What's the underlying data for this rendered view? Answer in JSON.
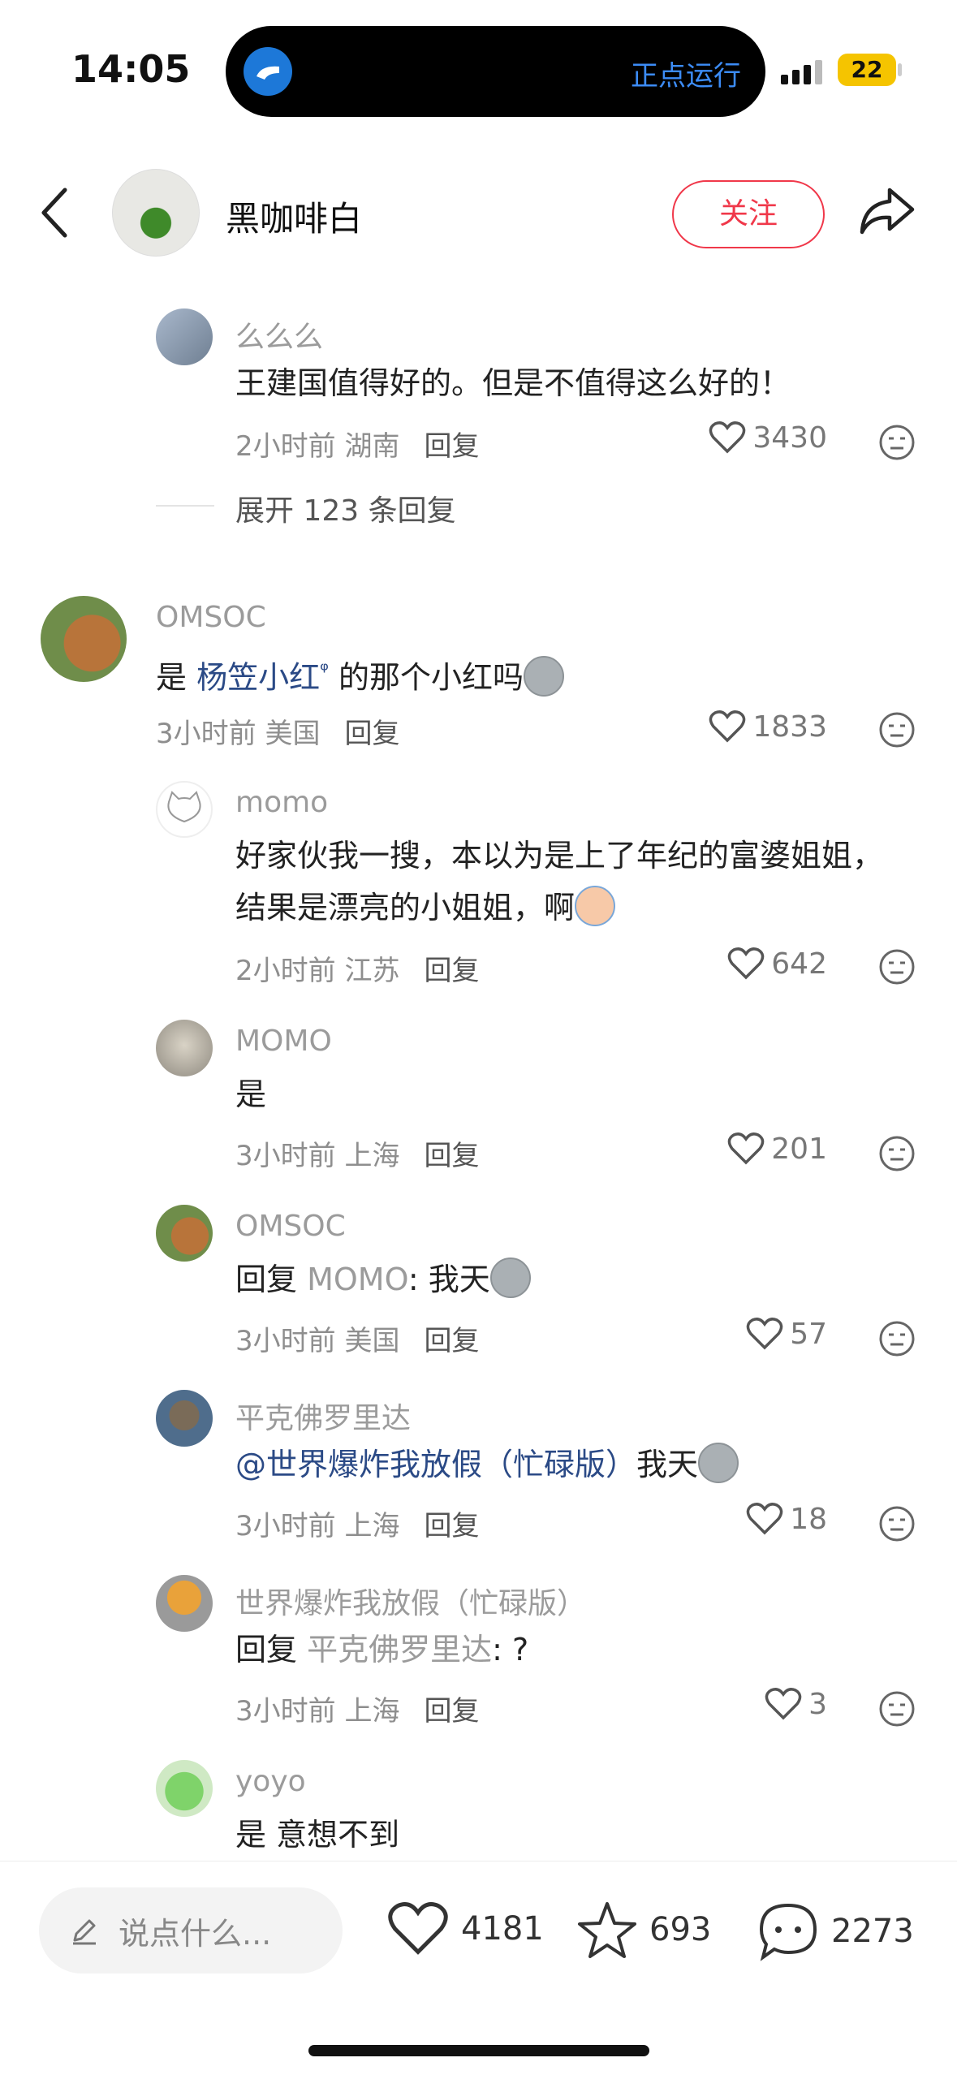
{
  "status_bar": {
    "time": "14:05",
    "island_text": "正点运行",
    "battery": "22"
  },
  "header": {
    "username": "黑咖啡白",
    "follow_label": "关注"
  },
  "comments": [
    {
      "name": "么么么",
      "text": "王建国值得好的。但是不值得这么好的！",
      "time_loc": "2小时前 湖南",
      "reply": "回复",
      "likes": "3430"
    },
    {
      "name": "OMSOC",
      "text_link": "杨笠小红",
      "text_after": "的那个小红吗",
      "prefix": "是",
      "time_loc": "3小时前 美国",
      "reply": "回复",
      "likes": "1833"
    },
    {
      "name": "momo",
      "text": "好家伙我一搜，本以为是上了年纪的富婆姐姐，结果是漂亮的小姐姐，啊",
      "time_loc": "2小时前 江苏",
      "reply": "回复",
      "likes": "642"
    },
    {
      "name": "MOMO",
      "text": "是",
      "time_loc": "3小时前 上海",
      "reply": "回复",
      "likes": "201"
    },
    {
      "name": "OMSOC",
      "reply_prefix": "回复",
      "reply_to": "MOMO",
      "text": ": 我天",
      "time_loc": "3小时前 美国",
      "reply": "回复",
      "likes": "57"
    },
    {
      "name": "平克佛罗里达",
      "mention": "@世界爆炸我放假（忙碌版）",
      "text": "我天",
      "time_loc": "3小时前 上海",
      "reply": "回复",
      "likes": "18"
    },
    {
      "name": "世界爆炸我放假（忙碌版）",
      "reply_prefix": "回复",
      "reply_to": "平克佛罗里达",
      "text": ": ?",
      "time_loc": "3小时前 上海",
      "reply": "回复",
      "likes": "3"
    },
    {
      "name": "yoyo",
      "text": "是 意想不到"
    }
  ],
  "expand_text": "展开 123 条回复",
  "bottom_bar": {
    "input_placeholder": "说点什么...",
    "likes": "4181",
    "stars": "693",
    "comments": "2273"
  },
  "colors": {
    "accent_red": "#f0384a",
    "link_blue": "#2b4a86",
    "island_blue": "#3c8cf6",
    "battery_yellow": "#f5c400"
  }
}
